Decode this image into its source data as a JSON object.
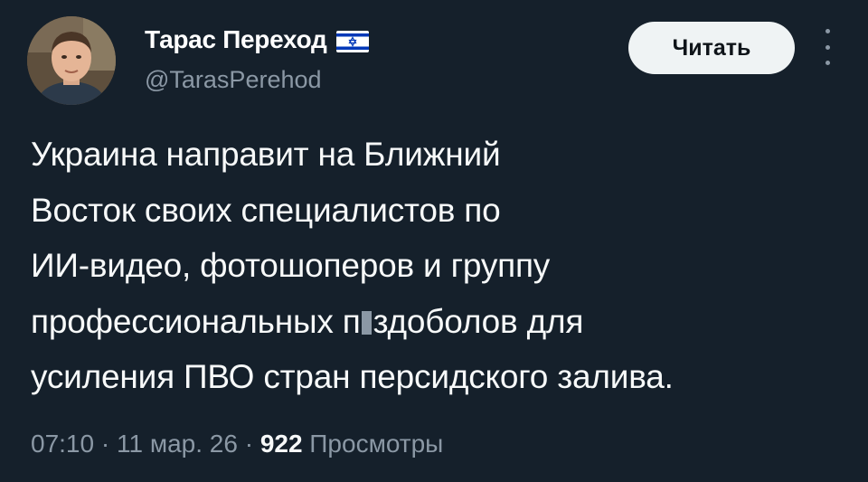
{
  "author": {
    "display_name": "Тарас Переход",
    "handle": "@TarasPerehod",
    "badge_icon": "israel-flag-icon"
  },
  "actions": {
    "follow_label": "Читать",
    "more_icon": "more-options-icon"
  },
  "tweet": {
    "lines": [
      "Украина направит на Ближний",
      "Восток своих специалистов по",
      "ИИ-видео, фотошоперов и группу"
    ],
    "line4_before": "профессиональных п",
    "line4_after": "здоболов для",
    "line5": "усиления ПВО стран персидского залива."
  },
  "meta": {
    "time": "07:10",
    "sep1": " · ",
    "date": "11 мар. 26",
    "sep2": " · ",
    "views_count": "922",
    "views_label": " Просмотры"
  },
  "colors": {
    "background": "#15202b",
    "text_primary": "#f7f9f9",
    "text_secondary": "#8b98a5",
    "button_bg": "#eff3f4",
    "flag_blue": "#0038b8"
  }
}
